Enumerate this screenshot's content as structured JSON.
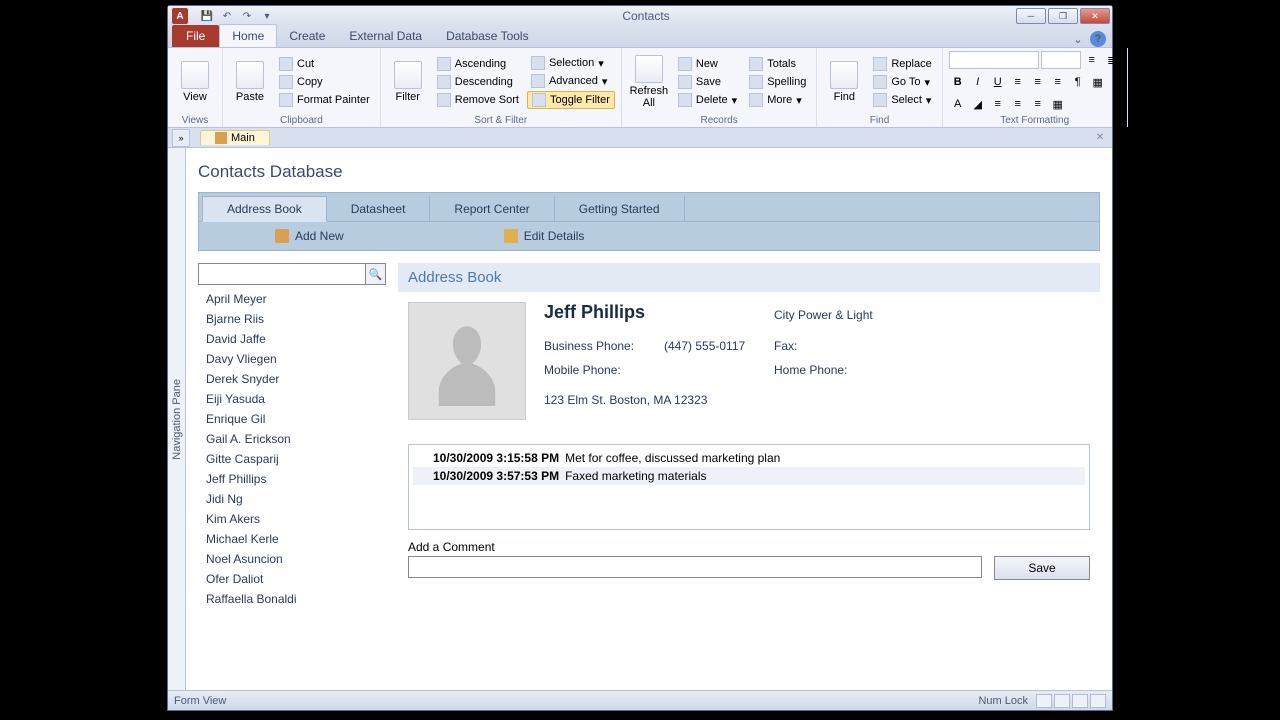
{
  "window": {
    "title": "Contacts"
  },
  "ribbon_tabs": {
    "file": "File",
    "home": "Home",
    "create": "Create",
    "external": "External Data",
    "dbtools": "Database Tools"
  },
  "ribbon": {
    "views": {
      "large": "View",
      "group": "Views"
    },
    "clipboard": {
      "large": "Paste",
      "cut": "Cut",
      "copy": "Copy",
      "fmt": "Format Painter",
      "group": "Clipboard"
    },
    "sortfilter": {
      "large": "Filter",
      "asc": "Ascending",
      "desc": "Descending",
      "remove": "Remove Sort",
      "sel": "Selection",
      "adv": "Advanced",
      "toggle": "Toggle Filter",
      "group": "Sort & Filter"
    },
    "records": {
      "large": "Refresh\nAll",
      "new": "New",
      "save": "Save",
      "delete": "Delete",
      "totals": "Totals",
      "spell": "Spelling",
      "more": "More",
      "group": "Records"
    },
    "find": {
      "large": "Find",
      "replace": "Replace",
      "goto": "Go To",
      "select": "Select",
      "group": "Find"
    },
    "textfmt": {
      "group": "Text Formatting"
    }
  },
  "doctab": {
    "main": "Main"
  },
  "form": {
    "title": "Contacts Database",
    "tabs": {
      "addr": "Address Book",
      "datasheet": "Datasheet",
      "report": "Report Center",
      "getstarted": "Getting Started"
    },
    "actions": {
      "addnew": "Add New",
      "edit": "Edit Details"
    },
    "navpane": "Navigation Pane"
  },
  "contacts": [
    "April Meyer",
    "Bjarne Riis",
    "David Jaffe",
    "Davy Vliegen",
    "Derek Snyder",
    "Eiji Yasuda",
    "Enrique Gil",
    "Gail A. Erickson",
    "Gitte Casparij",
    "Jeff Phillips",
    "Jidi Ng",
    "Kim Akers",
    "Michael Kerle",
    "Noel Asuncion",
    "Ofer Daliot",
    "Raffaella Bonaldi"
  ],
  "detail": {
    "header": "Address Book",
    "name": "Jeff Phillips",
    "company": "City Power & Light",
    "labels": {
      "bizphone": "Business Phone:",
      "mobphone": "Mobile Phone:",
      "fax": "Fax:",
      "homephone": "Home Phone:"
    },
    "bizphone": "(447) 555-0117",
    "address": "123 Elm St. Boston, MA 12323",
    "notes": [
      {
        "date": "10/30/2009 3:15:58 PM",
        "text": "Met for coffee, discussed marketing plan"
      },
      {
        "date": "10/30/2009 3:57:53 PM",
        "text": "Faxed marketing materials"
      }
    ],
    "commentlabel": "Add a Comment",
    "save": "Save"
  },
  "status": {
    "left": "Form View",
    "numlock": "Num Lock"
  }
}
